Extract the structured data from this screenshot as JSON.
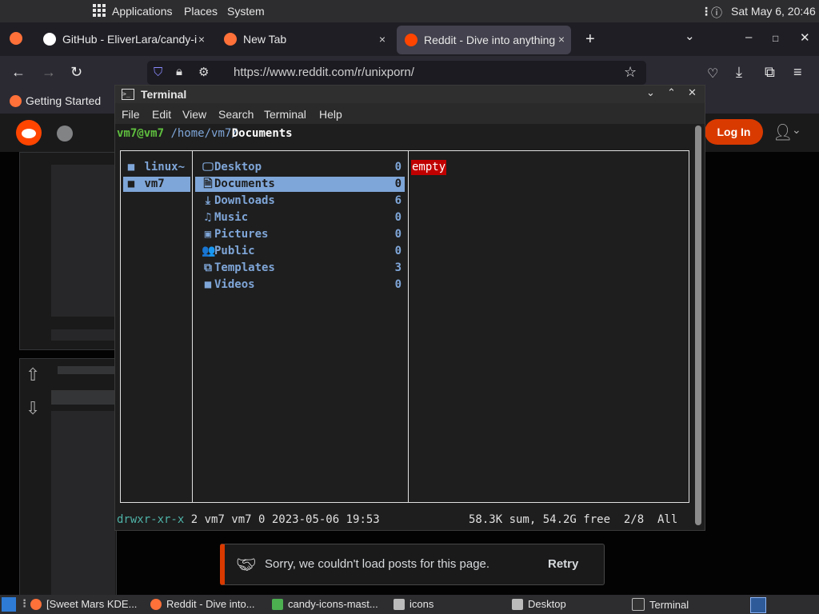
{
  "top_panel": {
    "applications": "Applications",
    "places": "Places",
    "system": "System",
    "datetime": "Sat May 6, 20:46"
  },
  "tabs": [
    {
      "label": "GitHub - EliverLara/candy-i",
      "close": "×"
    },
    {
      "label": "New Tab",
      "close": "×"
    },
    {
      "label": "Reddit - Dive into anything",
      "close": "×"
    }
  ],
  "new_tab": "+",
  "window_controls": {
    "list": "⌄",
    "minimize": "–",
    "maximize": "□",
    "close": "✕"
  },
  "nav": {
    "back": "←",
    "forward": "→",
    "reload": "↻",
    "url": "https://www.reddit.com/r/unixporn/",
    "bookmark": "☆",
    "pocket": "♡",
    "download": "⤓",
    "extensions": "⧉",
    "menu": "≡"
  },
  "bookmarks": {
    "getting_started": "Getting Started"
  },
  "reddit": {
    "login": "Log In",
    "avatar_caret": "⌄",
    "up": "⇧",
    "down": "⇩"
  },
  "terminal": {
    "title": "Terminal",
    "controls": {
      "min": "⌄",
      "max": "⌃",
      "close": "✕"
    },
    "menu": [
      "File",
      "Edit",
      "View",
      "Search",
      "Terminal",
      "Help"
    ],
    "prompt": {
      "user": "vm7@vm7",
      "path": "/home/vm7/",
      "cwd": "Documents"
    },
    "parents": [
      {
        "name": "linux~",
        "icon": "■",
        "selected": false
      },
      {
        "name": "vm7",
        "icon": "■",
        "selected": true
      }
    ],
    "entries": [
      {
        "name": "Desktop",
        "icon": "🖵",
        "count": "0"
      },
      {
        "name": "Documents",
        "icon": "🗎",
        "count": "0"
      },
      {
        "name": "Downloads",
        "icon": "⤓",
        "count": "6"
      },
      {
        "name": "Music",
        "icon": "♫",
        "count": "0"
      },
      {
        "name": "Pictures",
        "icon": "▣",
        "count": "0"
      },
      {
        "name": "Public",
        "icon": "👥",
        "count": "0"
      },
      {
        "name": "Templates",
        "icon": "⧉",
        "count": "3"
      },
      {
        "name": "Videos",
        "icon": "■",
        "count": "0"
      }
    ],
    "preview": "empty",
    "status": {
      "perms": "drwxr-xr-x",
      "info": "2 vm7 vm7 0 2023-05-06 19:53",
      "summary": "58.3K sum, 54.2G free  2/8  All"
    }
  },
  "toast": {
    "message": "Sorry, we couldn't load posts for this page.",
    "retry": "Retry"
  },
  "taskbar": [
    {
      "label": "[Sweet Mars KDE..."
    },
    {
      "label": "Reddit - Dive into..."
    },
    {
      "label": "candy-icons-mast..."
    },
    {
      "label": "icons"
    },
    {
      "label": "Desktop"
    },
    {
      "label": "Terminal"
    }
  ],
  "colors": {
    "reddit_orange": "#ff4500",
    "selection": "#7fa6d8",
    "prompt_green": "#5fbf3f",
    "warn_red": "#c00000"
  }
}
